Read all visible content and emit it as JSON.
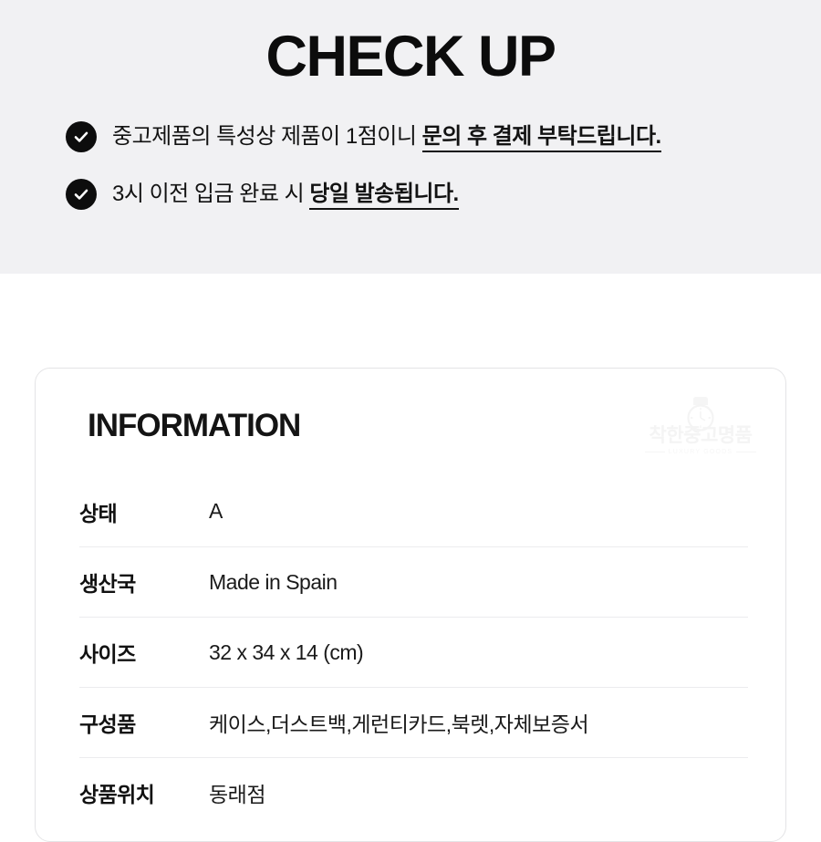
{
  "checkup": {
    "title": "CHECK UP",
    "items": [
      {
        "icon": "check-circle-icon",
        "normal": "중고제품의 특성상 제품이 1점이니 ",
        "emphasis": "문의 후 결제 부탁드립니다."
      },
      {
        "icon": "check-circle-icon",
        "normal": "3시 이전 입금 완료 시 ",
        "emphasis": "당일 발송됩니다."
      }
    ]
  },
  "information": {
    "title": "INFORMATION",
    "watermark": {
      "brand": "착한중고명품",
      "subtitle": "LUXURY GOODS",
      "icon": "wristwatch-icon"
    },
    "rows": [
      {
        "label": "상태",
        "value": "A"
      },
      {
        "label": "생산국",
        "value": "Made in Spain"
      },
      {
        "label": "사이즈",
        "value": "32 x 34 x 14 (cm)"
      },
      {
        "label": "구성품",
        "value": "케이스,더스트백,게런티카드,북렛,자체보증서"
      },
      {
        "label": "상품위치",
        "value": "동래점"
      }
    ]
  },
  "colors": {
    "band_background": "#f1f1f3",
    "page_background": "#ffffff",
    "text": "#111111",
    "icon_fill": "#0d0d0d",
    "divider": "#ececee",
    "card_border": "#e4e4e6",
    "watermark": "#f4f4f4"
  }
}
